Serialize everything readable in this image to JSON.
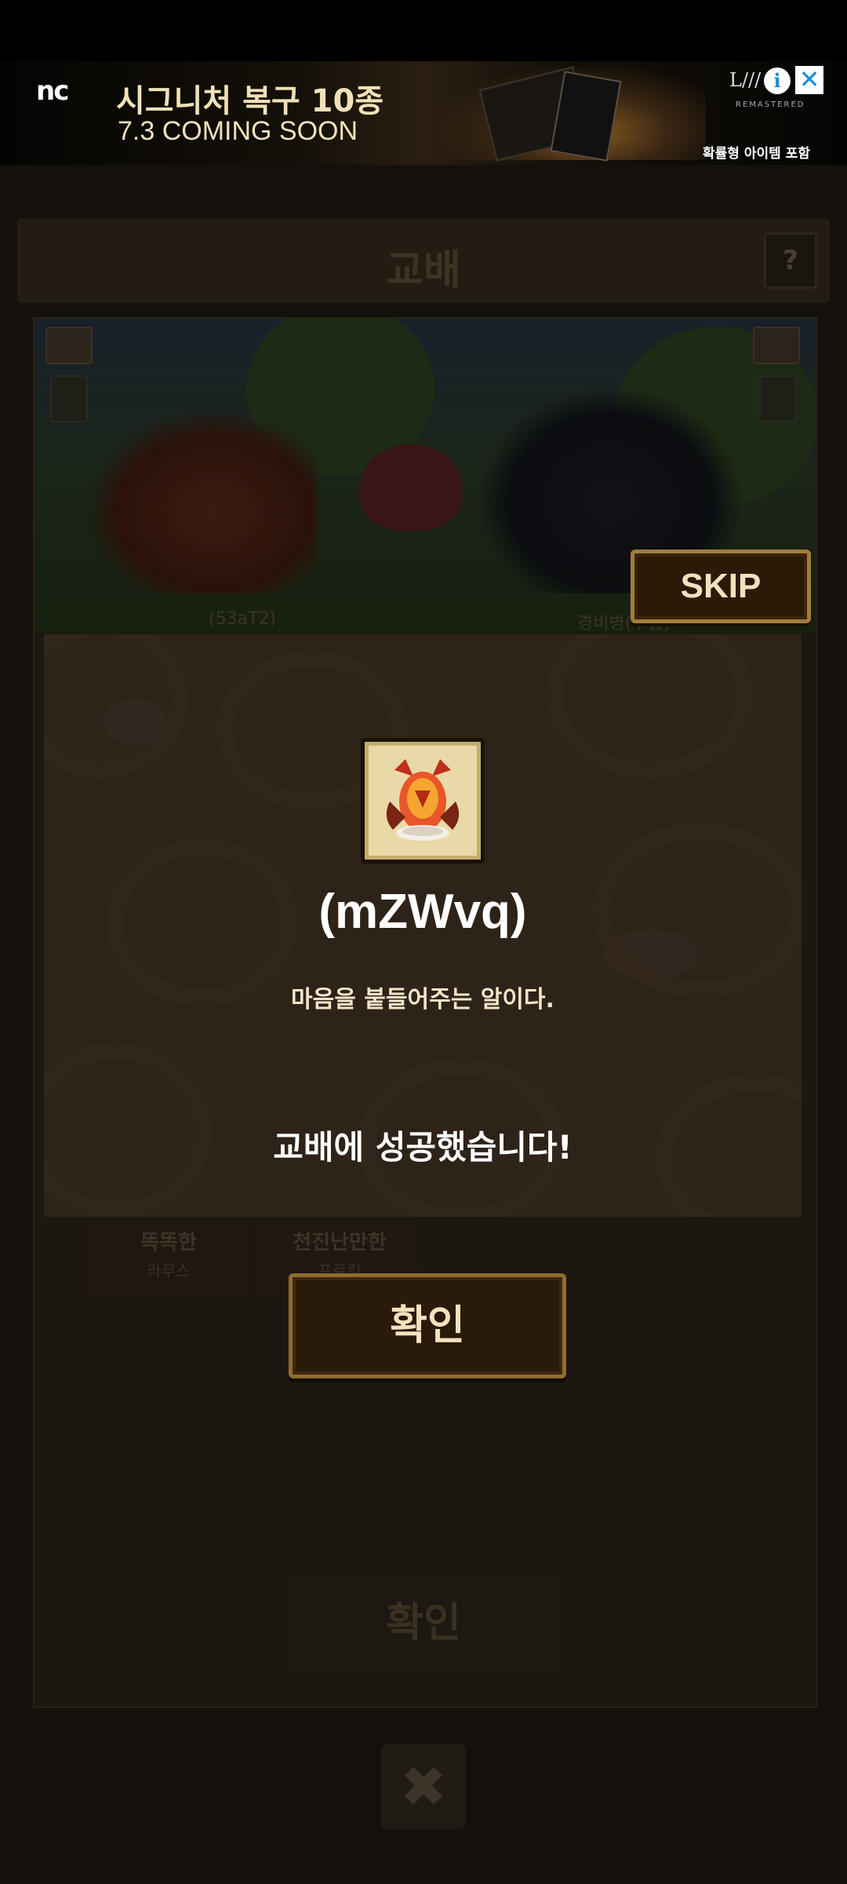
{
  "ad": {
    "logo": "nc",
    "headline": "시그니처 복구 10종",
    "subline": "7.3 COMING SOON",
    "brand": "L///",
    "brand_sub": "REMASTERED",
    "disclaimer": "확률형 아이템 포함",
    "info_icon": "i",
    "close_icon": "✕"
  },
  "game": {
    "title": "교배",
    "help_label": "?",
    "left_creature_name": "(53aT2)",
    "right_creature_name": "경비병(투갑)",
    "skip_label": "SKIP",
    "options": [
      {
        "line1": "똑똑한",
        "line2": "라무스"
      },
      {
        "line1": "천진난만한",
        "line2": "포르킨"
      }
    ],
    "background_confirm_label": "확인",
    "close_label": "✖"
  },
  "result": {
    "item_name": "(mZWvq)",
    "item_description": "마음을 붙들어주는 알이다.",
    "message": "교배에 성공했습니다!",
    "confirm_label": "확인",
    "item_icon": "dragon-egg-icon"
  }
}
